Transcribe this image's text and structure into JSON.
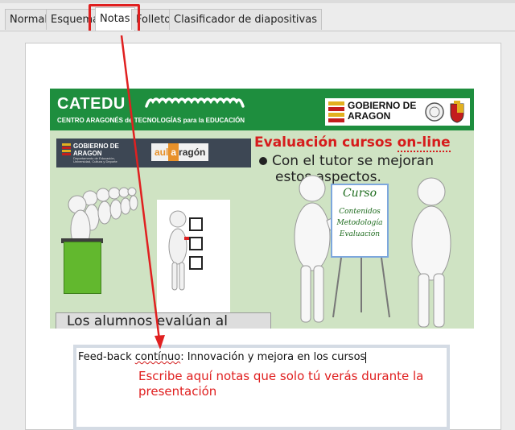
{
  "tabs": [
    {
      "label": "Normal"
    },
    {
      "label": "Esquema"
    },
    {
      "label": "Notas"
    },
    {
      "label": "Folleto"
    },
    {
      "label": "Clasificador de diapositivas"
    }
  ],
  "active_tab": "Notas",
  "slide": {
    "header_logo": "CATEDU",
    "header_subtitle": "CENTRO ARAGONÉS de TECNOLOGÍAS para la EDUCACIÓN",
    "gov_logo_right": "GOBIERNO DE ARAGON",
    "gov_logo_left": "GOBIERNO DE ARAGON",
    "gov_logo_left_sub": "Departamento de Educación, Universidad, Cultura y Deporte",
    "aula_logo_a": "aul",
    "aula_logo_b": "a",
    "aula_logo_c": "ragón",
    "title_prefix": "Evaluación cursos ",
    "title_underlined": "on-line",
    "bullet_line1": "Con el tutor se mejoran",
    "bullet_line2": "estos aspectos.",
    "board": {
      "title": "Curso",
      "lines": [
        "Contenidos",
        "Metodología",
        "Evaluación"
      ]
    },
    "caption": "Los alumnos evalúan al"
  },
  "notes": {
    "pre": "Feed-back ",
    "misspelled": "contínuo",
    "post": ": Innovación y mejora en los cursos"
  },
  "annotation": "Escribe aquí notas que solo tú verás durante la presentación",
  "colors": {
    "highlight": "#e02020",
    "slide_header": "#1e8e3e",
    "slide_bg": "#cfe3c3",
    "title_red": "#d61c1c"
  }
}
